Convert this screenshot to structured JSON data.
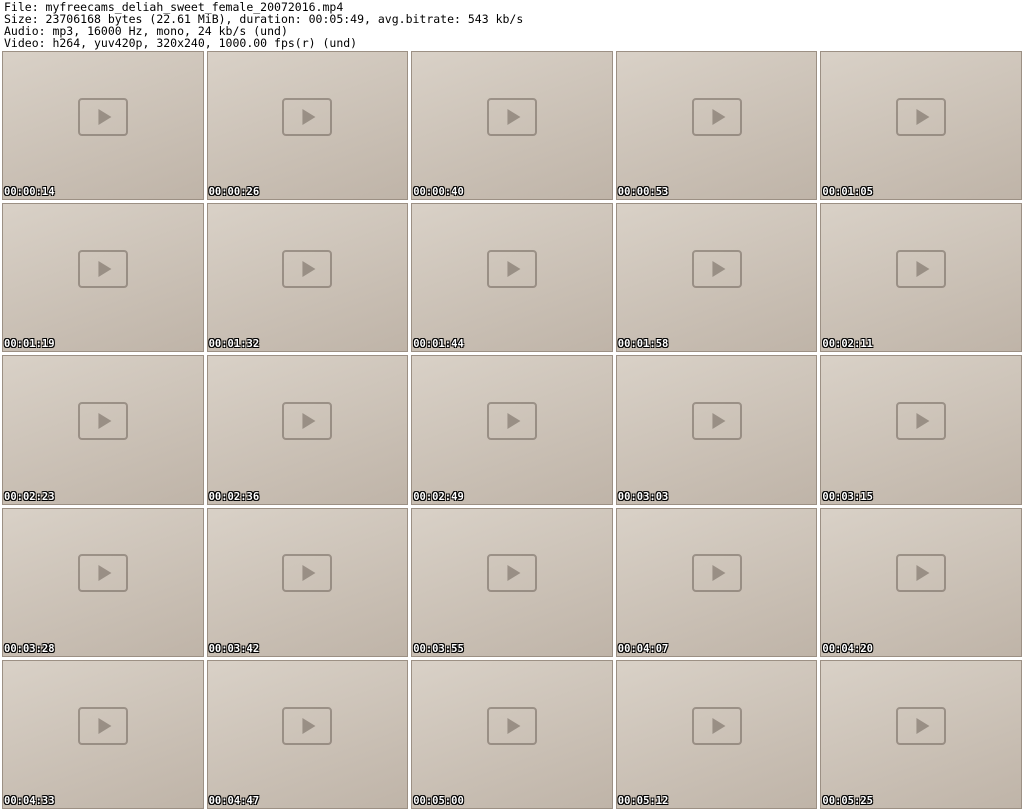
{
  "header": {
    "file_line": "File: myfreecams_deliah_sweet_female_20072016.mp4",
    "size_line": "Size: 23706168 bytes (22.61 MiB), duration: 00:05:49, avg.bitrate: 543 kb/s",
    "audio_line": "Audio: mp3, 16000 Hz, mono, 24 kb/s (und)",
    "video_line": "Video: h264, yuv420p, 320x240, 1000.00 fps(r) (und)"
  },
  "thumbnails": [
    {
      "timestamp": "00:00:14"
    },
    {
      "timestamp": "00:00:26"
    },
    {
      "timestamp": "00:00:40"
    },
    {
      "timestamp": "00:00:53"
    },
    {
      "timestamp": "00:01:05"
    },
    {
      "timestamp": "00:01:19"
    },
    {
      "timestamp": "00:01:32"
    },
    {
      "timestamp": "00:01:44"
    },
    {
      "timestamp": "00:01:58"
    },
    {
      "timestamp": "00:02:11"
    },
    {
      "timestamp": "00:02:23"
    },
    {
      "timestamp": "00:02:36"
    },
    {
      "timestamp": "00:02:49"
    },
    {
      "timestamp": "00:03:03"
    },
    {
      "timestamp": "00:03:15"
    },
    {
      "timestamp": "00:03:28"
    },
    {
      "timestamp": "00:03:42"
    },
    {
      "timestamp": "00:03:55"
    },
    {
      "timestamp": "00:04:07"
    },
    {
      "timestamp": "00:04:20"
    },
    {
      "timestamp": "00:04:33"
    },
    {
      "timestamp": "00:04:47"
    },
    {
      "timestamp": "00:05:00"
    },
    {
      "timestamp": "00:05:12"
    },
    {
      "timestamp": "00:05:25"
    }
  ]
}
